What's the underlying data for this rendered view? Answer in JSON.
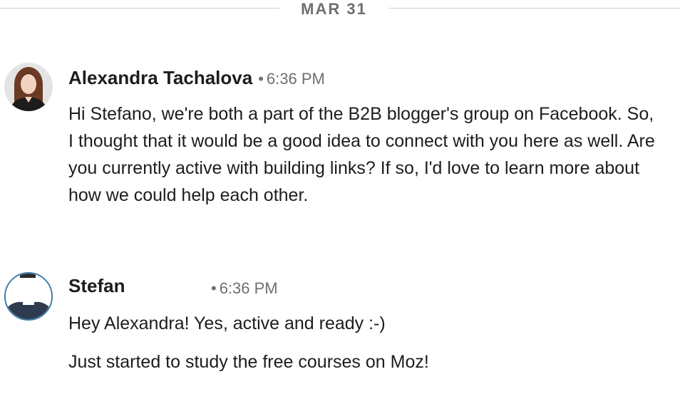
{
  "date_divider": {
    "label": "MAR 31"
  },
  "messages": [
    {
      "sender": "Alexandra Tachalova",
      "separator": "•",
      "time": "6:36 PM",
      "paragraphs": [
        "Hi Stefano, we're both a part of the B2B blogger's group on Facebook. So, I thought that it would be a good idea to connect with you here as well. Are you currently active with building links? If so, I'd love to learn more about how we could help each other."
      ],
      "avatar_icon": "profile-photo-icon"
    },
    {
      "sender": "Stefan",
      "separator": "•",
      "time": "6:36 PM",
      "paragraphs": [
        "Hey Alexandra! Yes, active and ready :-)",
        "Just started to study the free courses on Moz!"
      ],
      "avatar_icon": "profile-photo-icon"
    }
  ],
  "colors": {
    "text": "#1d1d1d",
    "muted": "#6f6f6f",
    "divider": "#cfcfcf",
    "avatar_ring": "#3e7ca6"
  }
}
